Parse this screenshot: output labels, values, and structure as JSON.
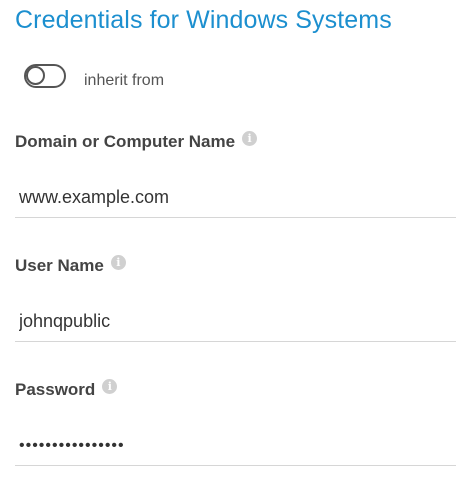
{
  "panel": {
    "title": "Credentials for Windows Systems"
  },
  "inherit": {
    "label": "inherit from",
    "enabled": false
  },
  "fields": {
    "domain": {
      "label": "Domain or Computer Name",
      "value": "www.example.com",
      "info_icon": "info-icon"
    },
    "username": {
      "label": "User Name",
      "value": "johnqpublic",
      "info_icon": "info-icon"
    },
    "password": {
      "label": "Password",
      "value": "................",
      "info_icon": "info-icon"
    }
  },
  "colors": {
    "title": "#1c8fcf",
    "label": "#444444",
    "divider": "#d6d6d6",
    "info_icon": "#d0d0d0"
  }
}
